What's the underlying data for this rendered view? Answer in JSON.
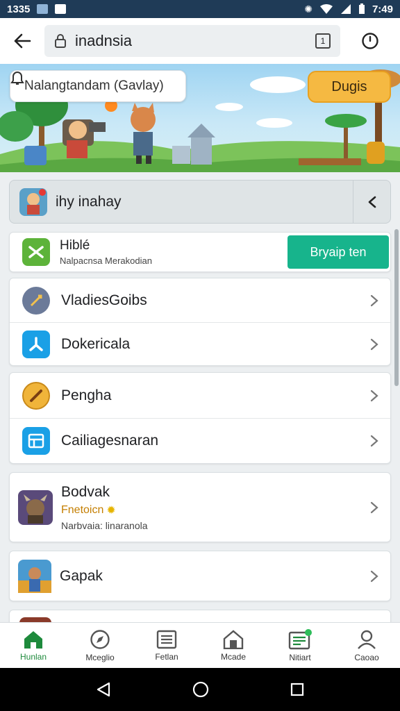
{
  "status_bar": {
    "time_left": "1335",
    "time_right": "7:49"
  },
  "browser": {
    "url": "inadnsia",
    "tab_count": "1"
  },
  "banner": {
    "notification_text": "Nalangtandam (Gavlay)",
    "cta_label": "Dugis"
  },
  "group": {
    "title": "ihy inahay"
  },
  "hub": {
    "title": "Hiblé",
    "subtitle": "Nalpacnsa Merakodian",
    "install_label": "Bryaip ten"
  },
  "menu_card_1": [
    {
      "label": "VladiesGoibs",
      "icon": "sword-icon"
    },
    {
      "label": "Dokericala",
      "icon": "fan-icon"
    }
  ],
  "menu_card_2": [
    {
      "label": "Pengha",
      "icon": "bat-icon"
    },
    {
      "label": "Cailiagesnaran",
      "icon": "calendar-icon"
    }
  ],
  "game_1": {
    "title": "Bodvak",
    "tag": "Fnetoicn",
    "subtitle": "Narbvaia: linaranola"
  },
  "game_2": {
    "title": "Gapak"
  },
  "bottom_nav": [
    {
      "label": "Hunlan",
      "icon": "home-icon",
      "active": true
    },
    {
      "label": "Mceglio",
      "icon": "compass-icon",
      "active": false
    },
    {
      "label": "Fetlan",
      "icon": "news-icon",
      "active": false
    },
    {
      "label": "Mcade",
      "icon": "store-icon",
      "active": false
    },
    {
      "label": "Nitiart",
      "icon": "inbox-icon",
      "active": false
    },
    {
      "label": "Caoao",
      "icon": "profile-icon",
      "active": false
    }
  ],
  "colors": {
    "accent": "#17b48c",
    "banner_button": "#f5b942",
    "status_bar": "#1f3b57",
    "active_nav": "#1e8a3c"
  }
}
